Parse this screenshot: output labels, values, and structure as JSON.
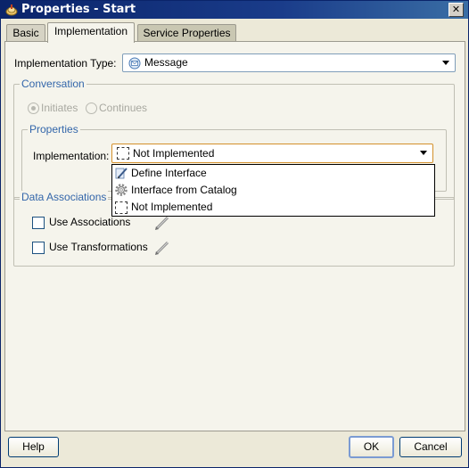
{
  "window": {
    "title": "Properties - Start",
    "close_glyph": "✕"
  },
  "tabs": [
    {
      "label": "Basic"
    },
    {
      "label": "Implementation"
    },
    {
      "label": "Service Properties"
    }
  ],
  "implementation_type": {
    "label": "Implementation Type:",
    "value": "Message",
    "icon": "message-icon"
  },
  "conversation": {
    "title": "Conversation",
    "initiates": "Initiates",
    "continues": "Continues",
    "selected": "Initiates"
  },
  "properties": {
    "title": "Properties",
    "implementation_label": "Implementation:",
    "implementation_value": "Not Implemented"
  },
  "dropdown_options": [
    {
      "label": "Define Interface",
      "icon": "define-interface-icon"
    },
    {
      "label": "Interface from Catalog",
      "icon": "gear-icon"
    },
    {
      "label": "Not Implemented",
      "icon": "dashed-box-icon"
    }
  ],
  "data_associations": {
    "title": "Data Associations",
    "use_associations": "Use Associations",
    "use_transformations": "Use Transformations"
  },
  "buttons": {
    "help": "Help",
    "ok": "OK",
    "cancel": "Cancel"
  },
  "colors": {
    "titlebar": "#0a246a",
    "group_title": "#3366aa",
    "panel": "#f5f4ec"
  }
}
